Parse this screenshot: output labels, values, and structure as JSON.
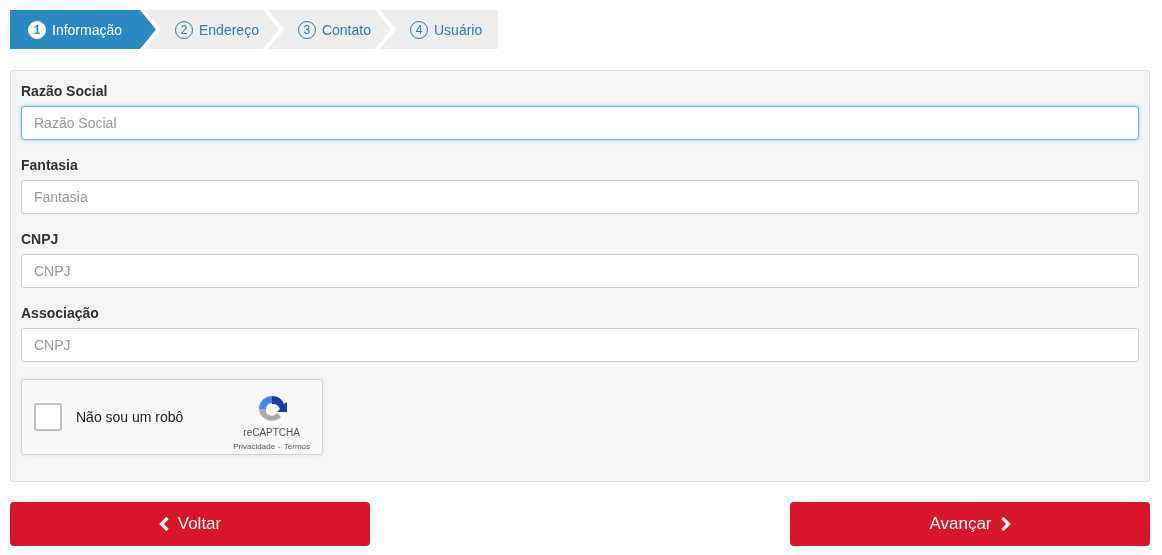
{
  "steps": [
    {
      "number": "1",
      "label": "Informação",
      "selected": true
    },
    {
      "number": "2",
      "label": "Endereço",
      "selected": false
    },
    {
      "number": "3",
      "label": "Contato",
      "selected": false
    },
    {
      "number": "4",
      "label": "Usuário",
      "selected": false
    }
  ],
  "fields": [
    {
      "label": "Razão Social",
      "placeholder": "Razão Social",
      "focused": true
    },
    {
      "label": "Fantasia",
      "placeholder": "Fantasia",
      "focused": false
    },
    {
      "label": "CNPJ",
      "placeholder": "CNPJ",
      "focused": false
    },
    {
      "label": "Associação",
      "placeholder": "CNPJ",
      "focused": false
    }
  ],
  "captcha": {
    "label": "Não sou um robô",
    "checked": false,
    "brand": "reCAPTCHA",
    "privacy": "Privacidade",
    "separator": "-",
    "terms": "Termos"
  },
  "buttons": [
    {
      "label": "Voltar",
      "kind": "back"
    },
    {
      "label": "Avançar",
      "kind": "next"
    }
  ]
}
